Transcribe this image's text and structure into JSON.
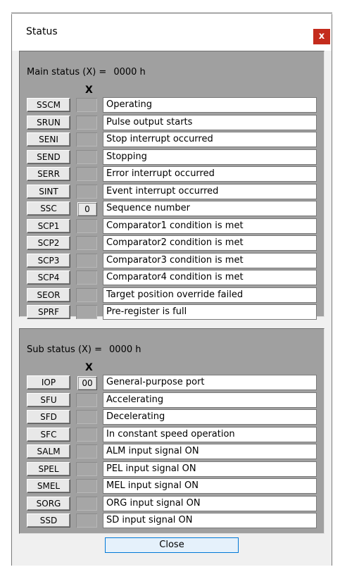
{
  "window": {
    "title": "Status",
    "close_x": "x",
    "close_button": "Close"
  },
  "main_status": {
    "label": "Main status (X) =",
    "value": "0000 h",
    "column_header": "X",
    "rows": [
      {
        "reg": "SSCM",
        "bit": "",
        "desc": "Operating"
      },
      {
        "reg": "SRUN",
        "bit": "",
        "desc": "Pulse output starts"
      },
      {
        "reg": "SENI",
        "bit": "",
        "desc": "Stop interrupt occurred"
      },
      {
        "reg": "SEND",
        "bit": "",
        "desc": "Stopping"
      },
      {
        "reg": "SERR",
        "bit": "",
        "desc": "Error interrupt occurred"
      },
      {
        "reg": "SINT",
        "bit": "",
        "desc": "Event interrupt occurred"
      },
      {
        "reg": "SSC",
        "bit": "0",
        "desc": "Sequence number"
      },
      {
        "reg": "SCP1",
        "bit": "",
        "desc": "Comparator1 condition is met"
      },
      {
        "reg": "SCP2",
        "bit": "",
        "desc": "Comparator2 condition is met"
      },
      {
        "reg": "SCP3",
        "bit": "",
        "desc": "Comparator3 condition is met"
      },
      {
        "reg": "SCP4",
        "bit": "",
        "desc": "Comparator4 condition is met"
      },
      {
        "reg": "SEOR",
        "bit": "",
        "desc": "Target position override failed"
      },
      {
        "reg": "SPRF",
        "bit": "",
        "desc": "Pre-register is full"
      }
    ]
  },
  "sub_status": {
    "label": "Sub status (X) =",
    "value": "0000 h",
    "column_header": "X",
    "rows": [
      {
        "reg": "IOP",
        "bit": "00",
        "desc": "General-purpose port"
      },
      {
        "reg": "SFU",
        "bit": "",
        "desc": "Accelerating"
      },
      {
        "reg": "SFD",
        "bit": "",
        "desc": "Decelerating"
      },
      {
        "reg": "SFC",
        "bit": "",
        "desc": "In constant speed operation"
      },
      {
        "reg": "SALM",
        "bit": "",
        "desc": "ALM input signal ON"
      },
      {
        "reg": "SPEL",
        "bit": "",
        "desc": "PEL input signal ON"
      },
      {
        "reg": "SMEL",
        "bit": "",
        "desc": "MEL input signal ON"
      },
      {
        "reg": "SORG",
        "bit": "",
        "desc": "ORG input signal ON"
      },
      {
        "reg": "SSD",
        "bit": "",
        "desc": "SD input signal ON"
      }
    ]
  }
}
